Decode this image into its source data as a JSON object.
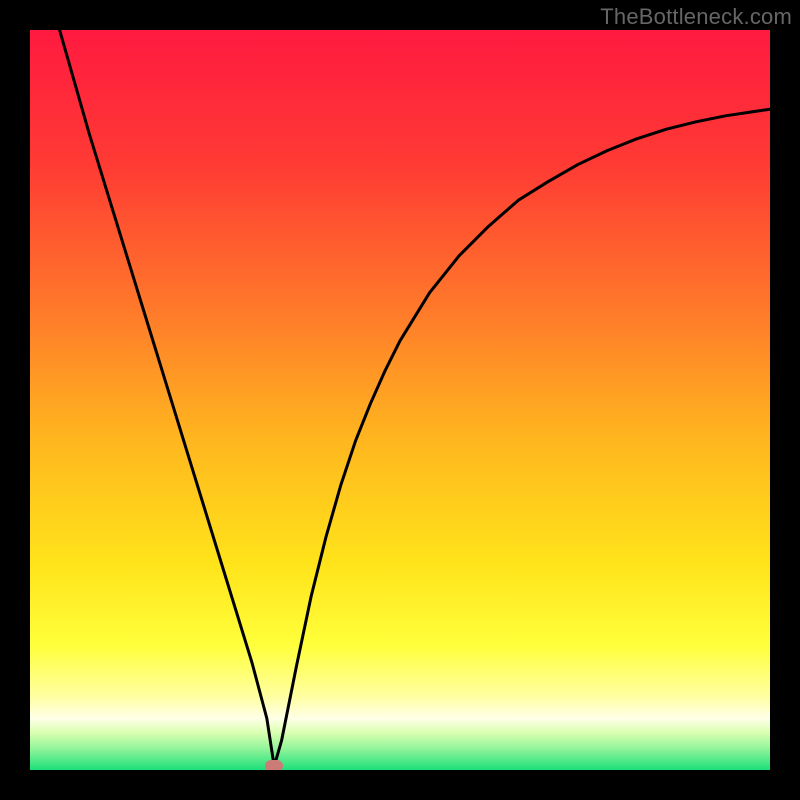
{
  "watermark": "TheBottleneck.com",
  "colors": {
    "frame": "#000000",
    "curve": "#000000",
    "marker": "#cc7b76",
    "gradient_stops": [
      {
        "pos": 0,
        "color": "#ff1a40"
      },
      {
        "pos": 18,
        "color": "#ff3a34"
      },
      {
        "pos": 38,
        "color": "#ff7a2a"
      },
      {
        "pos": 55,
        "color": "#ffb51f"
      },
      {
        "pos": 72,
        "color": "#ffe31a"
      },
      {
        "pos": 83,
        "color": "#ffff3a"
      },
      {
        "pos": 90,
        "color": "#ffffa0"
      },
      {
        "pos": 93,
        "color": "#ffffe8"
      },
      {
        "pos": 95,
        "color": "#d8ffb0"
      },
      {
        "pos": 97,
        "color": "#96f59c"
      },
      {
        "pos": 100,
        "color": "#1de07a"
      }
    ]
  },
  "chart_data": {
    "type": "line",
    "title": "",
    "xlabel": "",
    "ylabel": "",
    "xlim": [
      0,
      100
    ],
    "ylim": [
      0,
      100
    ],
    "grid": false,
    "legend": false,
    "marker": {
      "x": 33,
      "y": 0.5
    },
    "series": [
      {
        "name": "bottleneck-curve",
        "x": [
          4,
          6,
          8,
          10,
          12,
          14,
          16,
          18,
          20,
          22,
          24,
          26,
          28,
          30,
          32,
          33,
          34,
          35,
          36,
          38,
          40,
          42,
          44,
          46,
          48,
          50,
          54,
          58,
          62,
          66,
          70,
          74,
          78,
          82,
          86,
          90,
          94,
          98,
          100
        ],
        "y": [
          100,
          93,
          86,
          79.5,
          73,
          66.5,
          60,
          53.5,
          47,
          40.5,
          34,
          27.5,
          21,
          14.5,
          7,
          0.5,
          4,
          9,
          14,
          23.5,
          31.5,
          38.5,
          44.5,
          49.5,
          54,
          58,
          64.5,
          69.5,
          73.5,
          77,
          79.5,
          81.8,
          83.7,
          85.3,
          86.6,
          87.6,
          88.4,
          89,
          89.3
        ]
      }
    ]
  }
}
